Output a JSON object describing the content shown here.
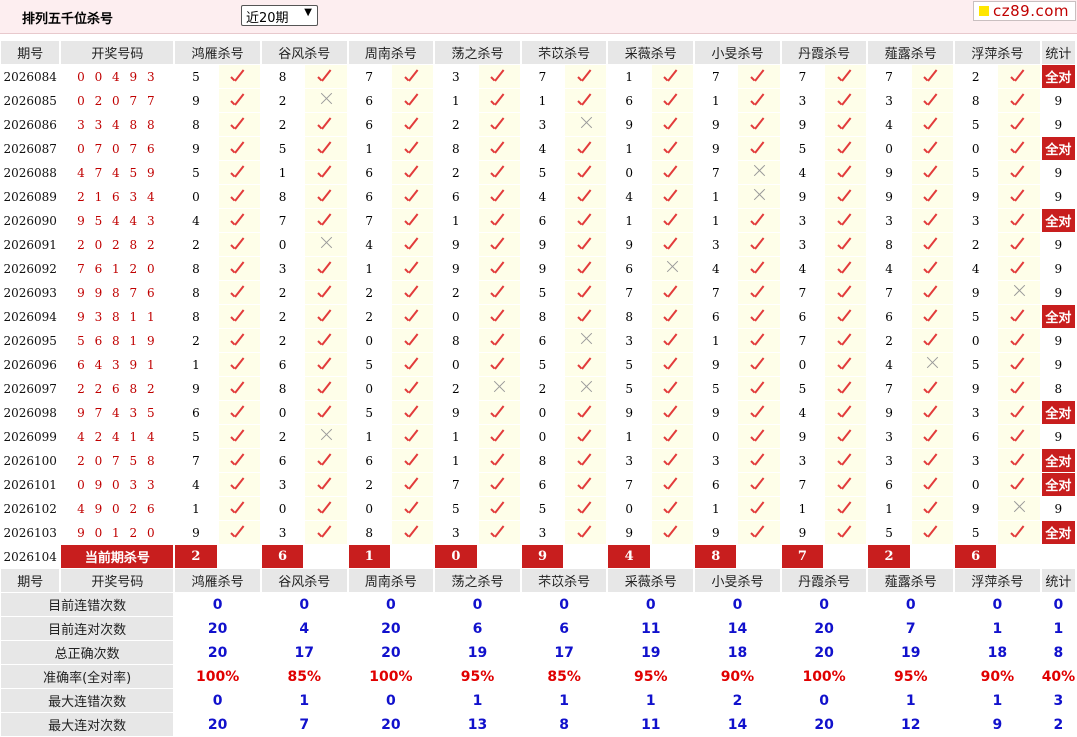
{
  "header": {
    "title": "排列五千位杀号",
    "select_value": "近20期",
    "logo_text": "cz89.com"
  },
  "colors": {
    "accent_red": "#c81e1e",
    "code_red": "#c00000",
    "stat_blue": "#1111cc",
    "check_red": "#e23b3b",
    "cross_gray": "#999999"
  },
  "columns": {
    "period": "期号",
    "code": "开奖号码",
    "experts": [
      "鸿雁杀号",
      "谷风杀号",
      "周南杀号",
      "荡之杀号",
      "芣苡杀号",
      "采薇杀号",
      "小旻杀号",
      "丹霞杀号",
      "薤露杀号",
      "浮萍杀号"
    ],
    "stat": "统计"
  },
  "rows": [
    {
      "period": "2026084",
      "code": "0 0 4 9 3",
      "kills": [
        5,
        8,
        7,
        3,
        7,
        1,
        7,
        7,
        7,
        2
      ],
      "marks": [
        "ok",
        "ok",
        "ok",
        "ok",
        "ok",
        "ok",
        "ok",
        "ok",
        "ok",
        "ok"
      ],
      "stat": "全对"
    },
    {
      "period": "2026085",
      "code": "0 2 0 7 7",
      "kills": [
        9,
        2,
        6,
        1,
        1,
        6,
        1,
        3,
        3,
        8
      ],
      "marks": [
        "ok",
        "ng",
        "ok",
        "ok",
        "ok",
        "ok",
        "ok",
        "ok",
        "ok",
        "ok"
      ],
      "stat": "9"
    },
    {
      "period": "2026086",
      "code": "3 3 4 8 8",
      "kills": [
        8,
        2,
        6,
        2,
        3,
        9,
        9,
        9,
        4,
        5
      ],
      "marks": [
        "ok",
        "ok",
        "ok",
        "ok",
        "ng",
        "ok",
        "ok",
        "ok",
        "ok",
        "ok"
      ],
      "stat": "9"
    },
    {
      "period": "2026087",
      "code": "0 7 0 7 6",
      "kills": [
        9,
        5,
        1,
        8,
        4,
        1,
        9,
        5,
        0,
        0
      ],
      "marks": [
        "ok",
        "ok",
        "ok",
        "ok",
        "ok",
        "ok",
        "ok",
        "ok",
        "ok",
        "ok"
      ],
      "stat": "全对"
    },
    {
      "period": "2026088",
      "code": "4 7 4 5 9",
      "kills": [
        5,
        1,
        6,
        2,
        5,
        0,
        7,
        4,
        9,
        5
      ],
      "marks": [
        "ok",
        "ok",
        "ok",
        "ok",
        "ok",
        "ok",
        "ng",
        "ok",
        "ok",
        "ok"
      ],
      "stat": "9"
    },
    {
      "period": "2026089",
      "code": "2 1 6 3 4",
      "kills": [
        0,
        8,
        6,
        6,
        4,
        4,
        1,
        9,
        9,
        9
      ],
      "marks": [
        "ok",
        "ok",
        "ok",
        "ok",
        "ok",
        "ok",
        "ng",
        "ok",
        "ok",
        "ok"
      ],
      "stat": "9"
    },
    {
      "period": "2026090",
      "code": "9 5 4 4 3",
      "kills": [
        4,
        7,
        7,
        1,
        6,
        1,
        1,
        3,
        3,
        3
      ],
      "marks": [
        "ok",
        "ok",
        "ok",
        "ok",
        "ok",
        "ok",
        "ok",
        "ok",
        "ok",
        "ok"
      ],
      "stat": "全对"
    },
    {
      "period": "2026091",
      "code": "2 0 2 8 2",
      "kills": [
        2,
        0,
        4,
        9,
        9,
        9,
        3,
        3,
        8,
        2
      ],
      "marks": [
        "ok",
        "ng",
        "ok",
        "ok",
        "ok",
        "ok",
        "ok",
        "ok",
        "ok",
        "ok"
      ],
      "stat": "9"
    },
    {
      "period": "2026092",
      "code": "7 6 1 2 0",
      "kills": [
        8,
        3,
        1,
        9,
        9,
        6,
        4,
        4,
        4,
        4
      ],
      "marks": [
        "ok",
        "ok",
        "ok",
        "ok",
        "ok",
        "ng",
        "ok",
        "ok",
        "ok",
        "ok"
      ],
      "stat": "9"
    },
    {
      "period": "2026093",
      "code": "9 9 8 7 6",
      "kills": [
        8,
        2,
        2,
        2,
        5,
        7,
        7,
        7,
        7,
        9
      ],
      "marks": [
        "ok",
        "ok",
        "ok",
        "ok",
        "ok",
        "ok",
        "ok",
        "ok",
        "ok",
        "ng"
      ],
      "stat": "9"
    },
    {
      "period": "2026094",
      "code": "9 3 8 1 1",
      "kills": [
        8,
        2,
        2,
        0,
        8,
        8,
        6,
        6,
        6,
        5
      ],
      "marks": [
        "ok",
        "ok",
        "ok",
        "ok",
        "ok",
        "ok",
        "ok",
        "ok",
        "ok",
        "ok"
      ],
      "stat": "全对"
    },
    {
      "period": "2026095",
      "code": "5 6 8 1 9",
      "kills": [
        2,
        2,
        0,
        8,
        6,
        3,
        1,
        7,
        2,
        0
      ],
      "marks": [
        "ok",
        "ok",
        "ok",
        "ok",
        "ng",
        "ok",
        "ok",
        "ok",
        "ok",
        "ok"
      ],
      "stat": "9"
    },
    {
      "period": "2026096",
      "code": "6 4 3 9 1",
      "kills": [
        1,
        6,
        5,
        0,
        5,
        5,
        9,
        0,
        4,
        5
      ],
      "marks": [
        "ok",
        "ok",
        "ok",
        "ok",
        "ok",
        "ok",
        "ok",
        "ok",
        "ng",
        "ok"
      ],
      "stat": "9"
    },
    {
      "period": "2026097",
      "code": "2 2 6 8 2",
      "kills": [
        9,
        8,
        0,
        2,
        2,
        5,
        5,
        5,
        7,
        9
      ],
      "marks": [
        "ok",
        "ok",
        "ok",
        "ng",
        "ng",
        "ok",
        "ok",
        "ok",
        "ok",
        "ok"
      ],
      "stat": "8"
    },
    {
      "period": "2026098",
      "code": "9 7 4 3 5",
      "kills": [
        6,
        0,
        5,
        9,
        0,
        9,
        9,
        4,
        9,
        3
      ],
      "marks": [
        "ok",
        "ok",
        "ok",
        "ok",
        "ok",
        "ok",
        "ok",
        "ok",
        "ok",
        "ok"
      ],
      "stat": "全对"
    },
    {
      "period": "2026099",
      "code": "4 2 4 1 4",
      "kills": [
        5,
        2,
        1,
        1,
        0,
        1,
        0,
        9,
        3,
        6
      ],
      "marks": [
        "ok",
        "ng",
        "ok",
        "ok",
        "ok",
        "ok",
        "ok",
        "ok",
        "ok",
        "ok"
      ],
      "stat": "9"
    },
    {
      "period": "2026100",
      "code": "2 0 7 5 8",
      "kills": [
        7,
        6,
        6,
        1,
        8,
        3,
        3,
        3,
        3,
        3
      ],
      "marks": [
        "ok",
        "ok",
        "ok",
        "ok",
        "ok",
        "ok",
        "ok",
        "ok",
        "ok",
        "ok"
      ],
      "stat": "全对"
    },
    {
      "period": "2026101",
      "code": "0 9 0 3 3",
      "kills": [
        4,
        3,
        2,
        7,
        6,
        7,
        6,
        7,
        6,
        0
      ],
      "marks": [
        "ok",
        "ok",
        "ok",
        "ok",
        "ok",
        "ok",
        "ok",
        "ok",
        "ok",
        "ok"
      ],
      "stat": "全对"
    },
    {
      "period": "2026102",
      "code": "4 9 0 2 6",
      "kills": [
        1,
        0,
        0,
        5,
        5,
        0,
        1,
        1,
        1,
        9
      ],
      "marks": [
        "ok",
        "ok",
        "ok",
        "ok",
        "ok",
        "ok",
        "ok",
        "ok",
        "ok",
        "ng"
      ],
      "stat": "9"
    },
    {
      "period": "2026103",
      "code": "9 0 1 2 0",
      "kills": [
        9,
        3,
        8,
        3,
        3,
        9,
        9,
        9,
        5,
        5
      ],
      "marks": [
        "ok",
        "ok",
        "ok",
        "ok",
        "ok",
        "ok",
        "ok",
        "ok",
        "ok",
        "ok"
      ],
      "stat": "全对"
    }
  ],
  "current": {
    "period": "2026104",
    "label": "当前期杀号",
    "kills": [
      "2",
      "6",
      "1",
      "0",
      "9",
      "4",
      "8",
      "7",
      "2",
      "6"
    ]
  },
  "summary": [
    {
      "label": "目前连错次数",
      "values": [
        "0",
        "0",
        "0",
        "0",
        "0",
        "0",
        "0",
        "0",
        "0",
        "0",
        "0"
      ]
    },
    {
      "label": "目前连对次数",
      "values": [
        "20",
        "4",
        "20",
        "6",
        "6",
        "11",
        "14",
        "20",
        "7",
        "1",
        "1"
      ]
    },
    {
      "label": "总正确次数",
      "values": [
        "20",
        "17",
        "20",
        "19",
        "17",
        "19",
        "18",
        "20",
        "19",
        "18",
        "8"
      ]
    },
    {
      "label": "准确率(全对率)",
      "values": [
        "100%",
        "85%",
        "100%",
        "95%",
        "85%",
        "95%",
        "90%",
        "100%",
        "95%",
        "90%",
        "40%"
      ],
      "red": true
    },
    {
      "label": "最大连错次数",
      "values": [
        "0",
        "1",
        "0",
        "1",
        "1",
        "1",
        "2",
        "0",
        "1",
        "1",
        "3"
      ]
    },
    {
      "label": "最大连对次数",
      "values": [
        "20",
        "7",
        "20",
        "13",
        "8",
        "11",
        "14",
        "20",
        "12",
        "9",
        "2"
      ]
    }
  ]
}
